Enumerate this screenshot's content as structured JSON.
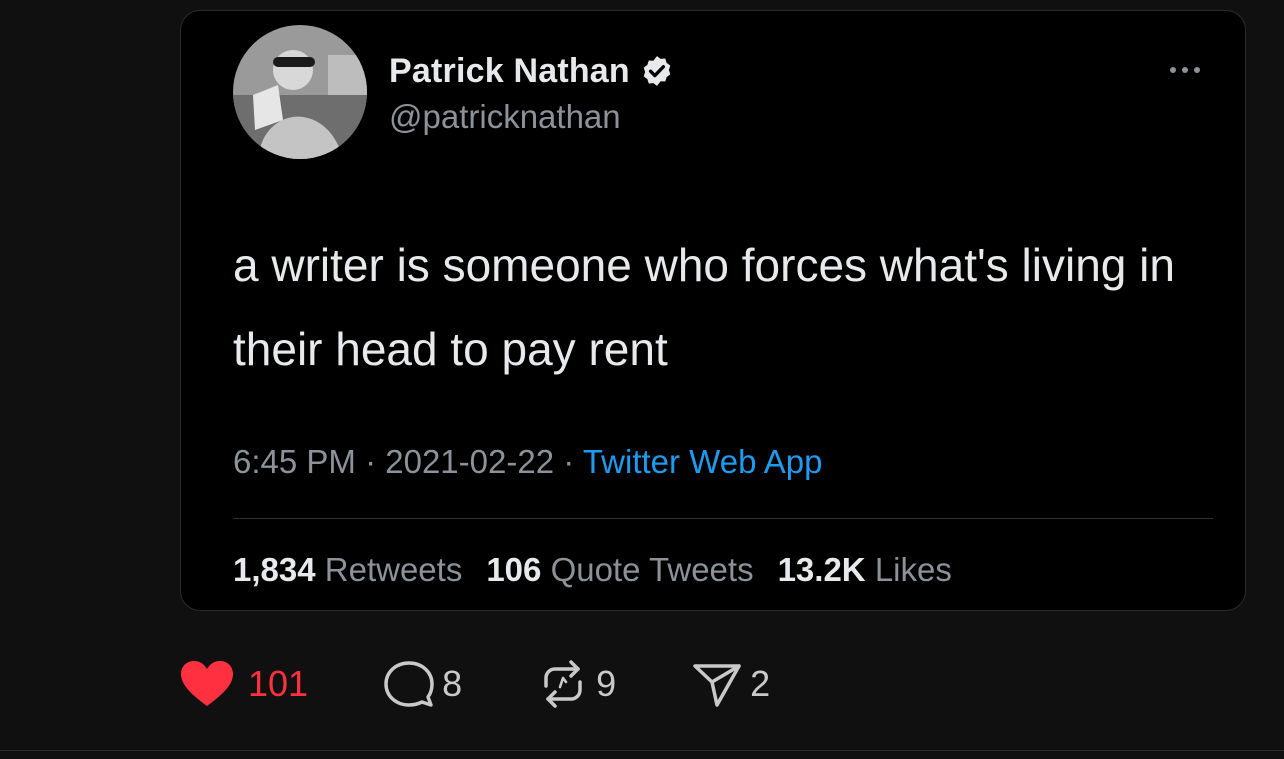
{
  "tweet": {
    "author_name": "Patrick Nathan",
    "author_handle": "@patricknathan",
    "text": "a writer is someone who forces what's living in their head to pay rent",
    "time": "6:45 PM",
    "separator": "·",
    "date": "2021-02-22",
    "source": "Twitter Web App",
    "stats": {
      "retweets_count": "1,834",
      "retweets_label": "Retweets",
      "quotes_count": "106",
      "quotes_label": "Quote Tweets",
      "likes_count": "13.2K",
      "likes_label": "Likes"
    },
    "icons": {
      "verified": "verified-badge-icon",
      "more": "more-options-icon"
    },
    "colors": {
      "link": "#1d9bf0",
      "card_background": "#000000"
    }
  },
  "actions": {
    "likes": "101",
    "comments": "8",
    "reposts": "9",
    "shares": "2",
    "icons": [
      "heart-icon",
      "comment-icon",
      "repost-icon",
      "share-icon"
    ],
    "colors": {
      "liked": "#ff3040",
      "default": "#c9c9c9"
    }
  },
  "page": {
    "background": "#101010"
  }
}
